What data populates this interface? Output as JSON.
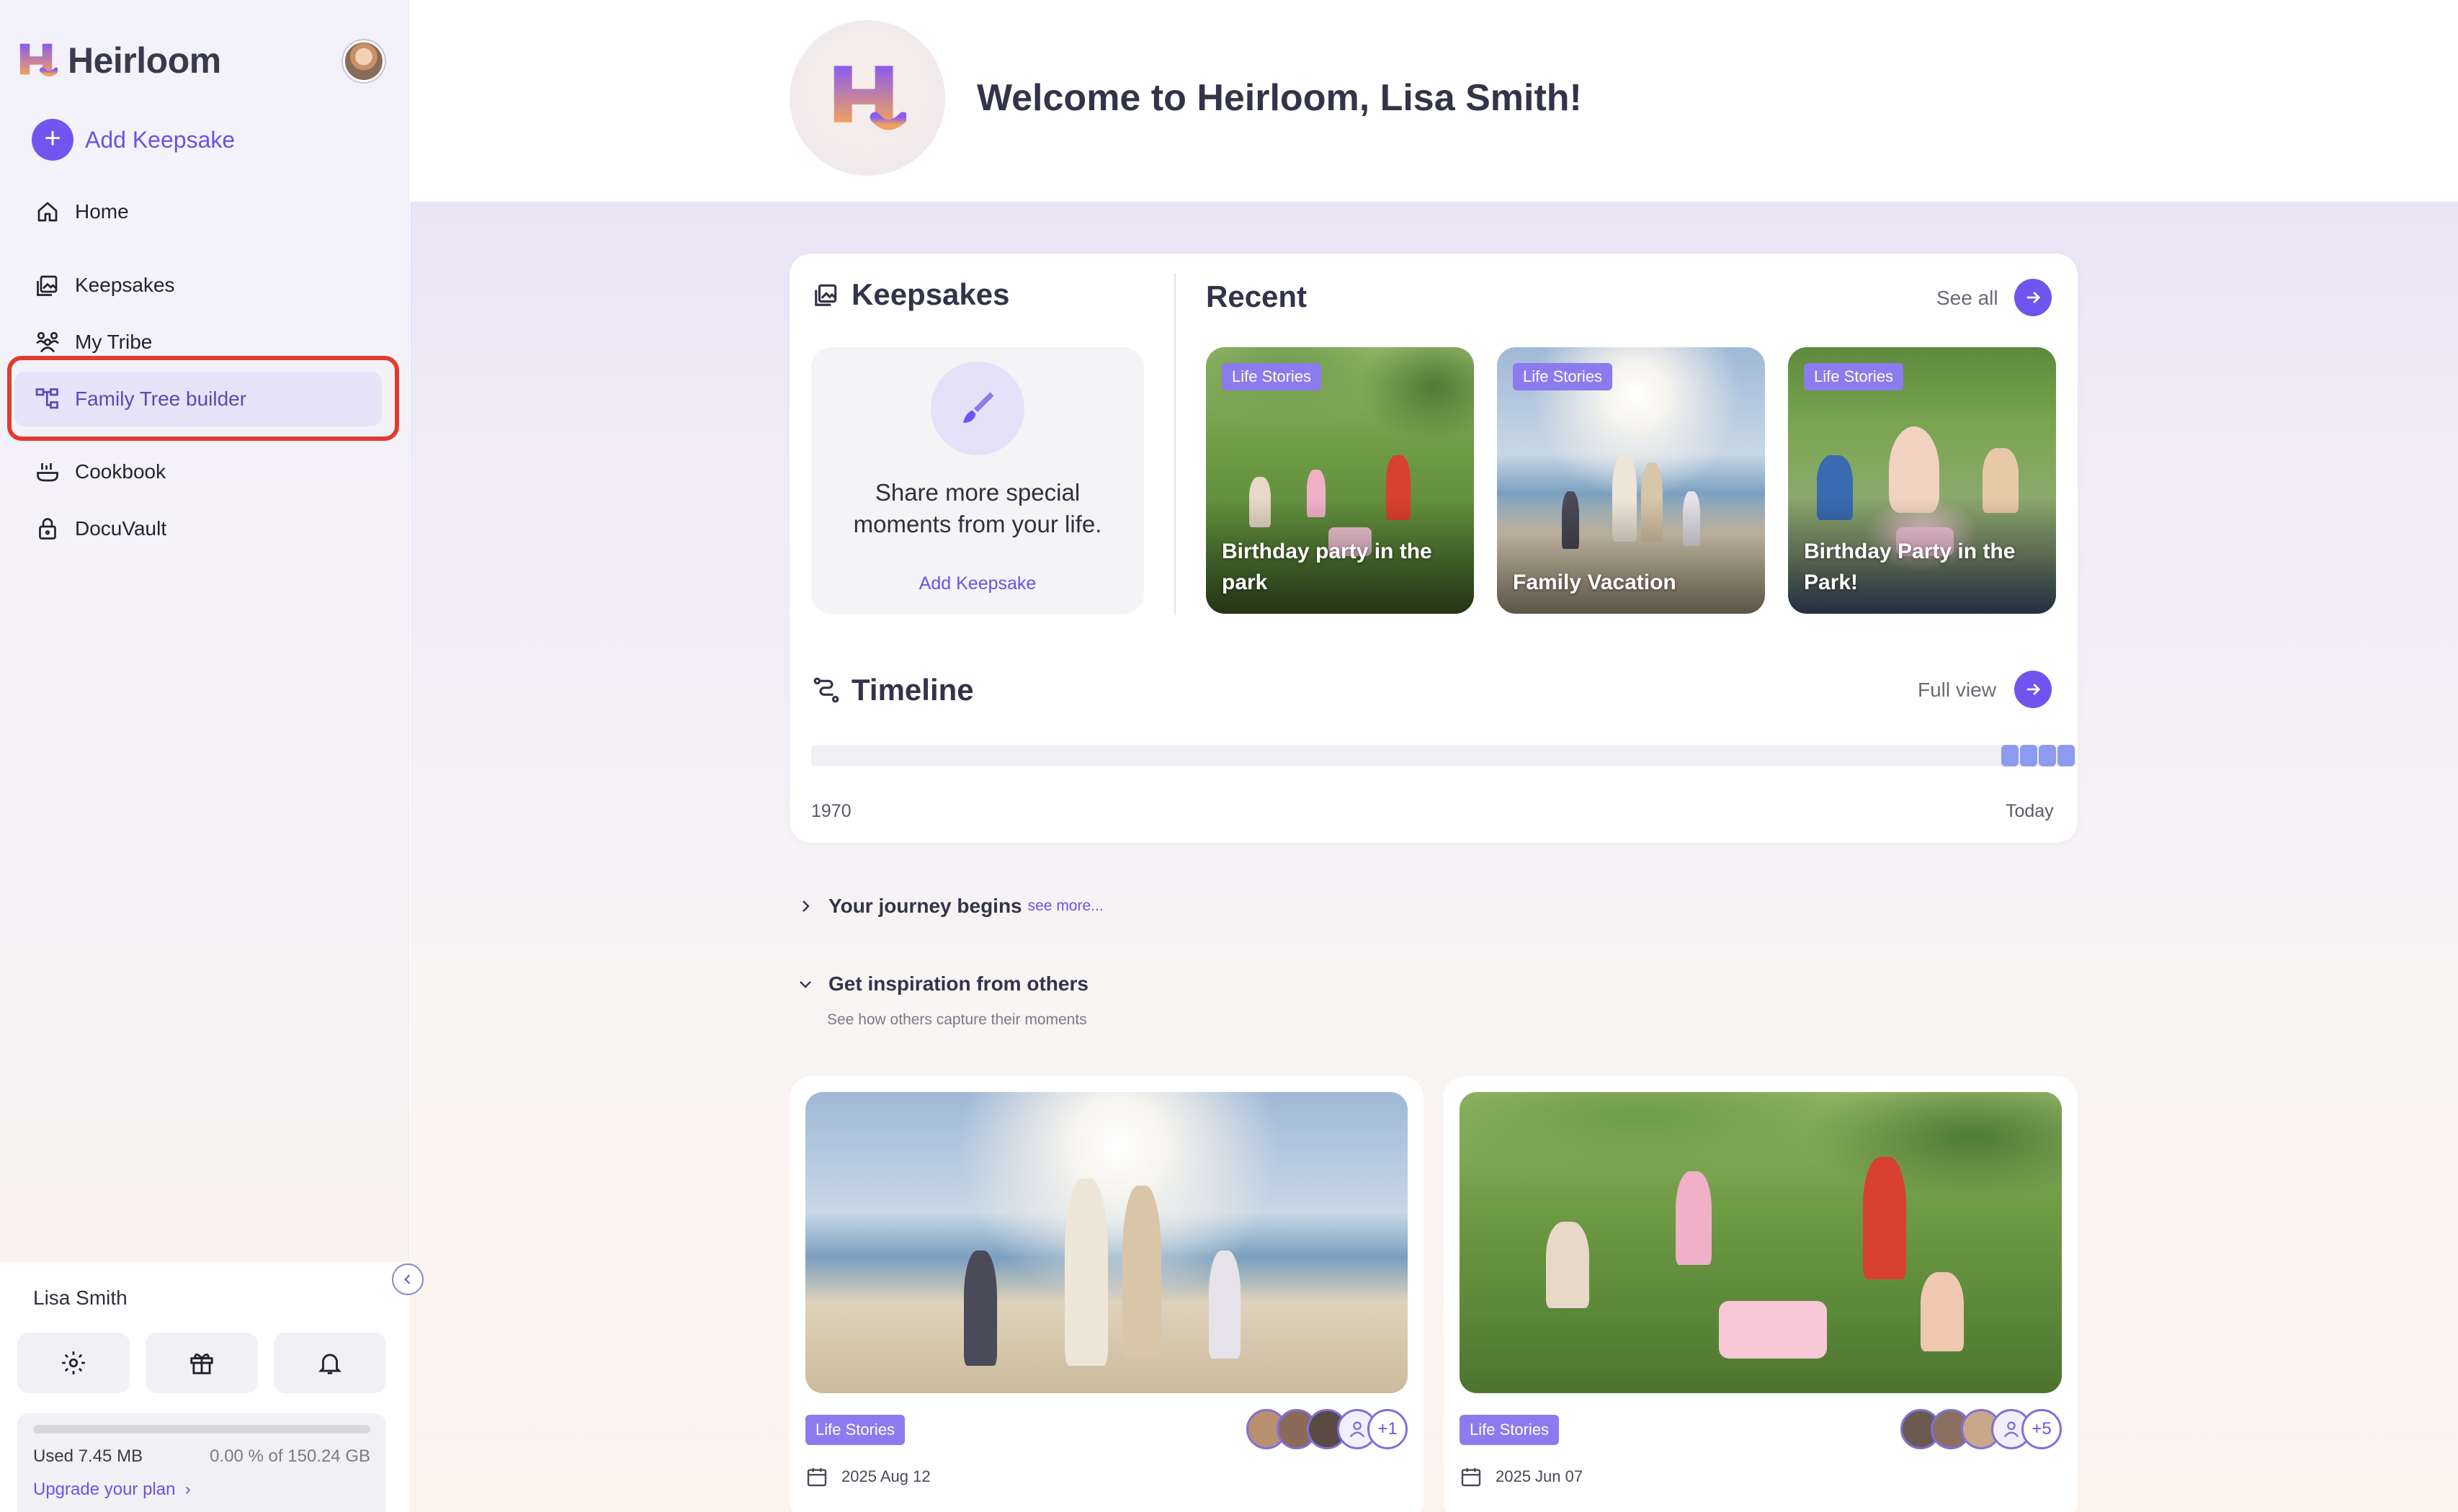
{
  "brand": {
    "name": "Heirloom"
  },
  "sidebar": {
    "add_keepsake": "Add Keepsake",
    "items": [
      {
        "label": "Home",
        "icon": "home-icon"
      },
      {
        "label": "Keepsakes",
        "icon": "gallery-icon"
      },
      {
        "label": "My Tribe",
        "icon": "people-icon"
      },
      {
        "label": "Family Tree builder",
        "icon": "tree-icon",
        "active": true
      },
      {
        "label": "Cookbook",
        "icon": "cooking-pot-icon"
      },
      {
        "label": "DocuVault",
        "icon": "lock-icon"
      }
    ],
    "user_name": "Lisa Smith",
    "storage": {
      "used": "Used 7.45 MB",
      "percent": "0.00 % of 150.24 GB",
      "fill_fraction": 0.0,
      "upgrade": "Upgrade your plan"
    }
  },
  "header": {
    "welcome": "Welcome to Heirloom, Lisa Smith!"
  },
  "keepsakes": {
    "title": "Keepsakes",
    "share_text": "Share more special moments from your life.",
    "add_link": "Add Keepsake"
  },
  "recent": {
    "title": "Recent",
    "see_all": "See all",
    "items": [
      {
        "tag": "Life Stories",
        "title": "Birthday party in the park"
      },
      {
        "tag": "Life Stories",
        "title": "Family Vacation"
      },
      {
        "tag": "Life Stories",
        "title": "Birthday Party in the Park!"
      }
    ]
  },
  "timeline": {
    "title": "Timeline",
    "full_view": "Full view",
    "start": "1970",
    "end": "Today"
  },
  "journey": {
    "title": "Your journey begins",
    "see_more": "see more..."
  },
  "inspiration": {
    "title": "Get inspiration from others",
    "subtitle": "See how others capture their moments",
    "cards": [
      {
        "tag": "Life Stories",
        "date": "2025 Aug 12",
        "extra_count": "+1"
      },
      {
        "tag": "Life Stories",
        "date": "2025 Jun 07",
        "extra_count": "+5"
      }
    ]
  },
  "colors": {
    "accent": "#6f54ee",
    "highlight": "#e23b2e",
    "tag": "#8c7bee"
  }
}
